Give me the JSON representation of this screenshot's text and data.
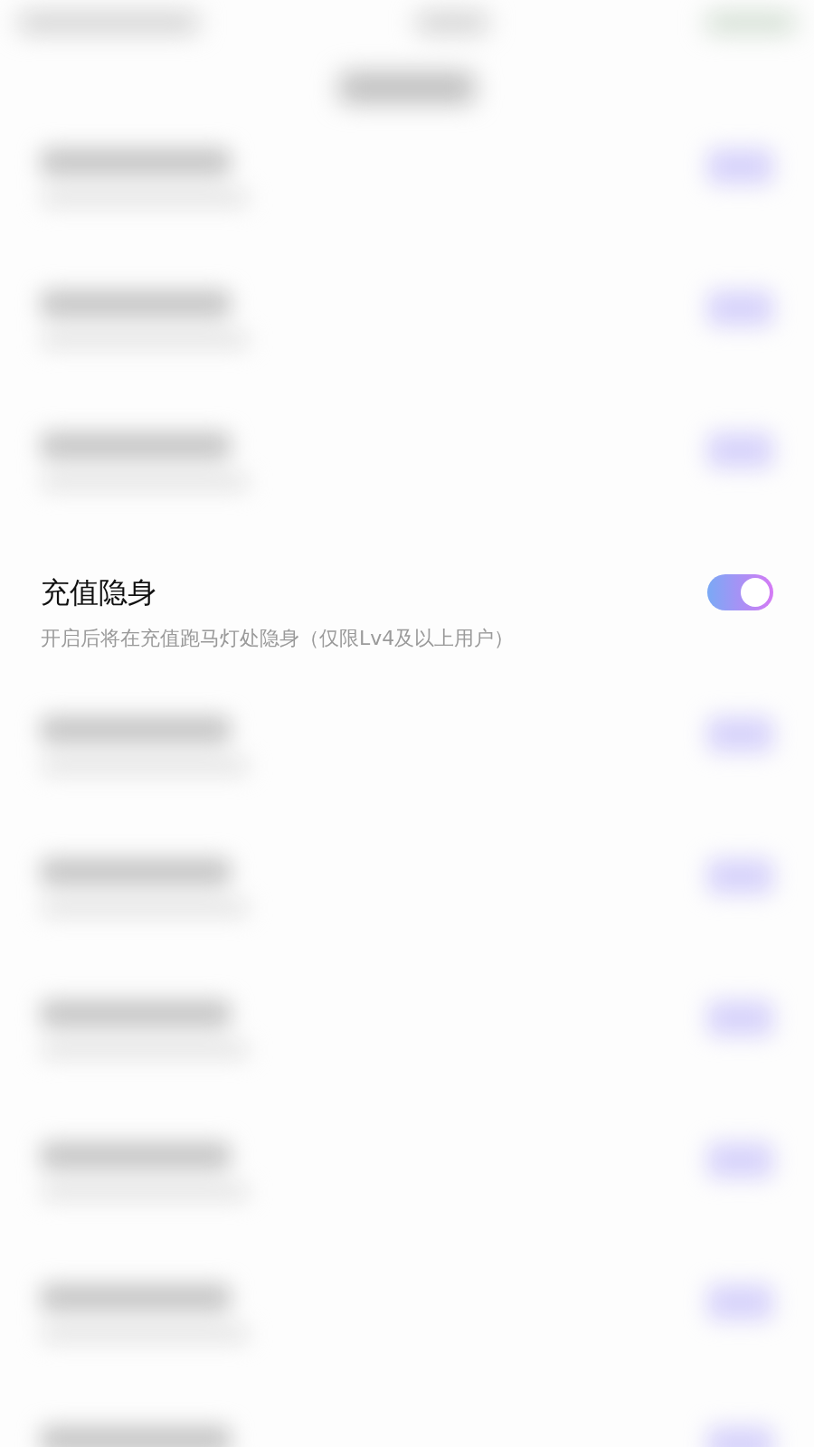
{
  "rows": [
    {
      "kind": "blurred"
    },
    {
      "kind": "blurred"
    },
    {
      "kind": "blurred"
    },
    {
      "kind": "setting",
      "title": "充值隐身",
      "description": "开启后将在充值跑马灯处隐身（仅限Lv4及以上用户）",
      "on": true
    },
    {
      "kind": "blurred"
    },
    {
      "kind": "blurred"
    },
    {
      "kind": "blurred"
    },
    {
      "kind": "blurred"
    },
    {
      "kind": "blurred"
    },
    {
      "kind": "blurred"
    }
  ]
}
